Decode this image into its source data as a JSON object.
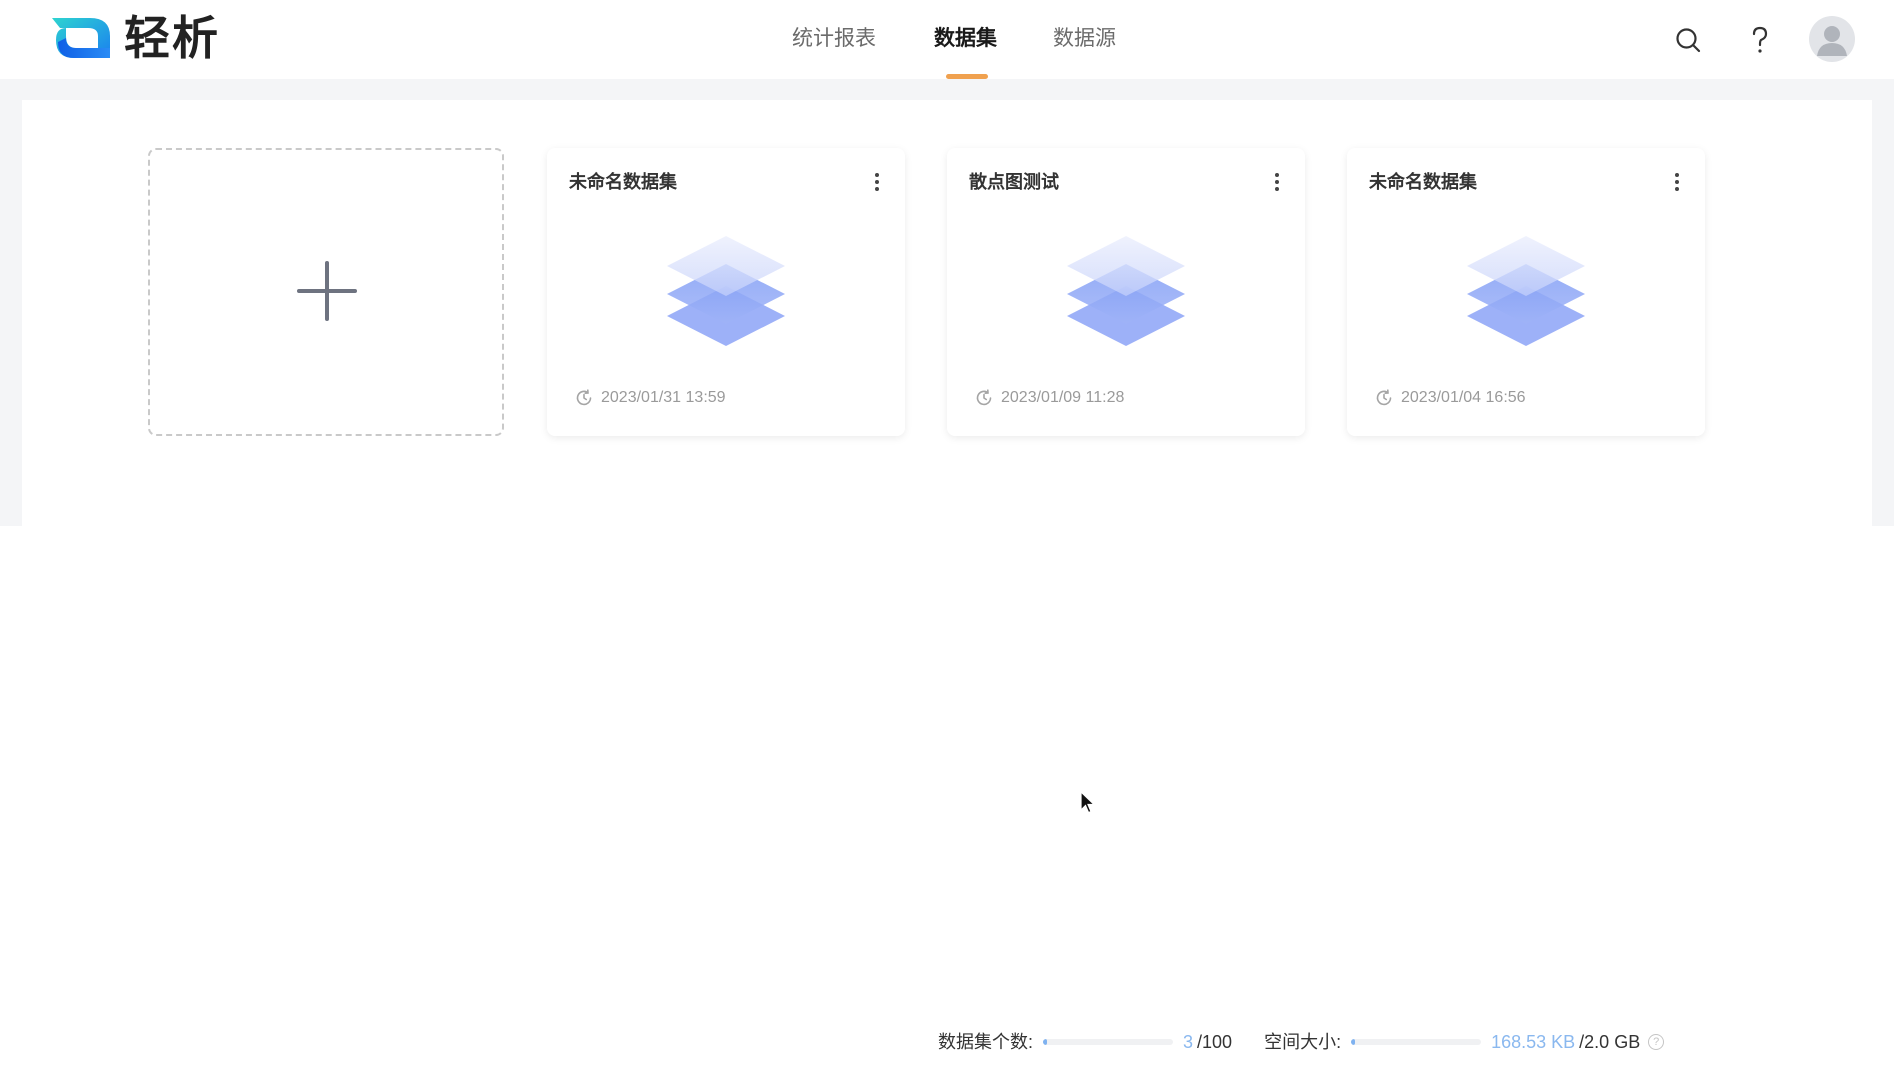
{
  "app": {
    "name": "轻析"
  },
  "nav": {
    "tabs": [
      {
        "label": "统计报表",
        "active": false
      },
      {
        "label": "数据集",
        "active": true
      },
      {
        "label": "数据源",
        "active": false
      }
    ],
    "accent_color": "#f0a14f"
  },
  "header": {
    "icons": [
      "search-icon",
      "help-icon",
      "avatar-icon"
    ]
  },
  "datasets": [
    {
      "title": "未命名数据集",
      "updated": "2023/01/31 13:59",
      "icon": "layers-icon"
    },
    {
      "title": "散点图测试",
      "updated": "2023/01/09 11:28",
      "icon": "layers-icon"
    },
    {
      "title": "未命名数据集",
      "updated": "2023/01/04 16:56",
      "icon": "layers-icon"
    }
  ],
  "new_card": {
    "icon": "plus-icon"
  },
  "stats": {
    "count_label": "数据集个数:",
    "count_value": "3",
    "count_max": "/100",
    "count_fraction": 0.03,
    "space_label": "空间大小:",
    "space_value": "168.53 KB",
    "space_max": "/2.0 GB",
    "space_fraction": 0.0001,
    "help_symbol": "?"
  },
  "colors": {
    "stat_accent": "#8ab8ef",
    "layer_blue": "#7f9cf5"
  }
}
